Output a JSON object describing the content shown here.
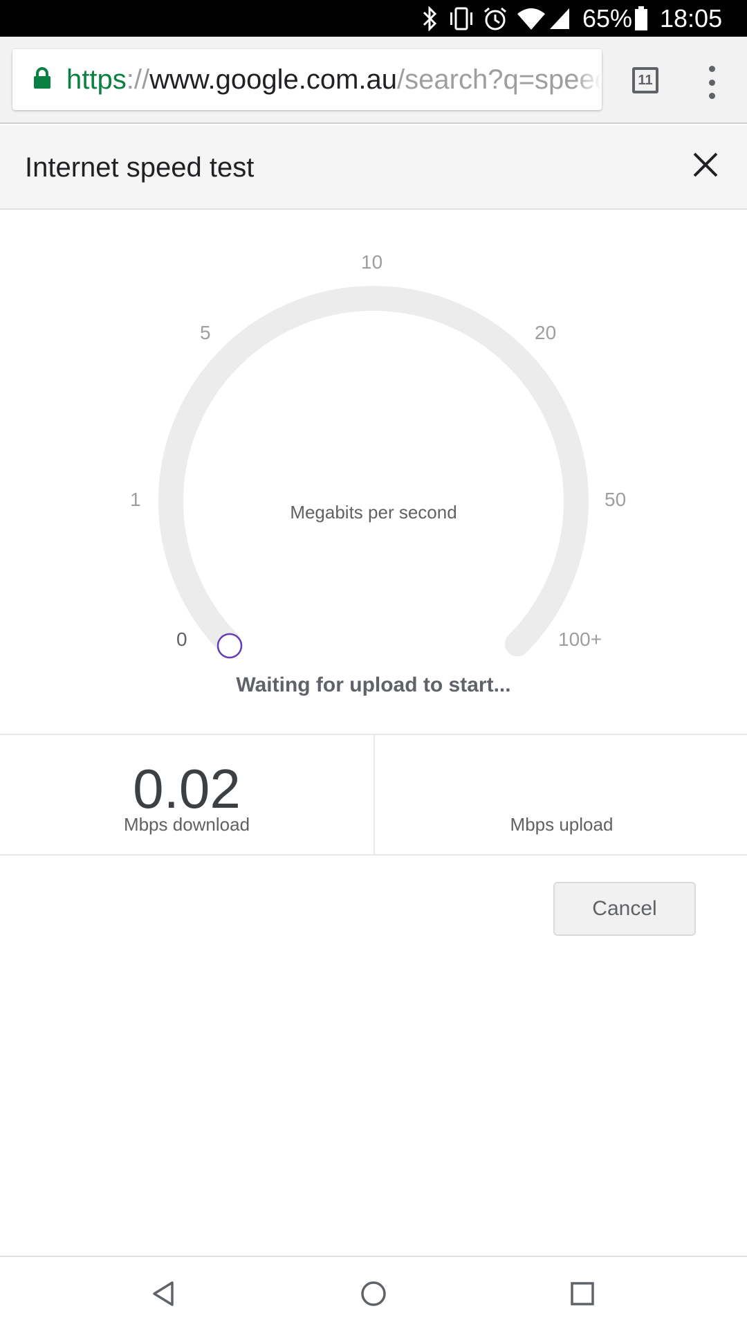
{
  "status_bar": {
    "battery_percent": "65%",
    "time": "18:05",
    "icons": [
      "bluetooth-icon",
      "vibrate-icon",
      "alarm-icon",
      "wifi-icon",
      "cell-signal-icon",
      "battery-icon"
    ]
  },
  "browser": {
    "url_scheme": "https",
    "url_separator": "://",
    "url_host": "www.google.com.au",
    "url_path": "/search?q=speed",
    "tab_count": "11",
    "colors": {
      "secure_green": "#0b8043",
      "toolbar_bg": "#f2f2f2"
    }
  },
  "panel": {
    "title": "Internet speed test"
  },
  "gauge": {
    "scale_labels": [
      "0",
      "1",
      "5",
      "10",
      "20",
      "50",
      "100+"
    ],
    "unit_caption": "Megabits per second",
    "status": "Waiting for upload to start...",
    "needle_value": 0,
    "colors": {
      "track": "#ececec",
      "indicator": "#673ab7"
    }
  },
  "results": {
    "download_value": "0.02",
    "download_label": "Mbps download",
    "upload_value": "",
    "upload_label": "Mbps upload"
  },
  "actions": {
    "cancel_label": "Cancel"
  },
  "nav_bar": {
    "buttons": [
      "back-icon",
      "home-icon",
      "recents-icon"
    ]
  }
}
